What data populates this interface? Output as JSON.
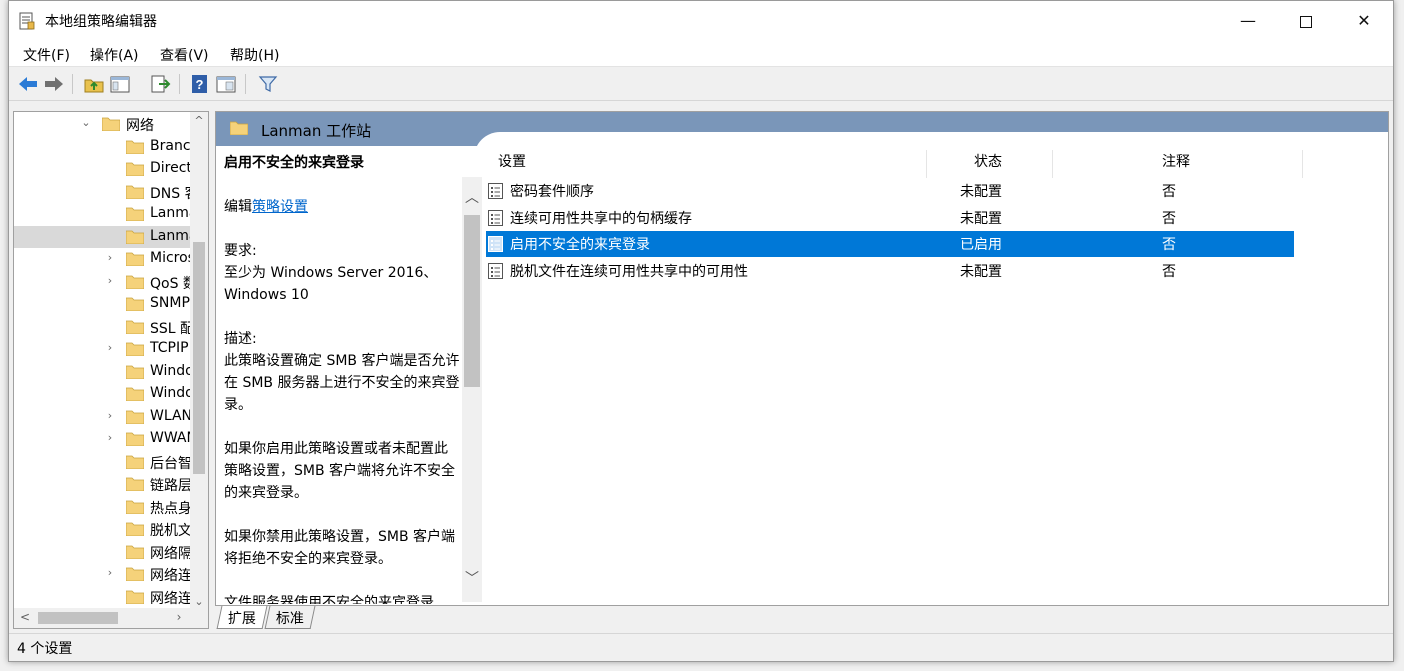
{
  "window": {
    "title": "本地组策略编辑器",
    "controls": {
      "minimize": "—",
      "close": "✕"
    }
  },
  "menu": [
    "文件(F)",
    "操作(A)",
    "查看(V)",
    "帮助(H)"
  ],
  "toolbar": {
    "icons": [
      "back-arrow-icon",
      "forward-arrow-icon",
      "folder-up-icon",
      "console-tree-icon",
      "export-list-icon",
      "help-icon",
      "properties-icon",
      "filter-icon"
    ]
  },
  "tree": {
    "items": [
      {
        "label": "网络",
        "expander": "⌄",
        "level": 0
      },
      {
        "label": "Branch",
        "expander": "",
        "level": 1
      },
      {
        "label": "Direct",
        "expander": "",
        "level": 1
      },
      {
        "label": "DNS 客",
        "expander": "",
        "level": 1
      },
      {
        "label": "Lanma",
        "expander": "",
        "level": 1
      },
      {
        "label": "Lanma",
        "expander": "",
        "level": 1,
        "selected": true
      },
      {
        "label": "Micros",
        "expander": "›",
        "level": 1
      },
      {
        "label": "QoS 数",
        "expander": "›",
        "level": 1
      },
      {
        "label": "SNMP",
        "expander": "",
        "level": 1
      },
      {
        "label": "SSL 配",
        "expander": "",
        "level": 1
      },
      {
        "label": "TCPIP",
        "expander": "›",
        "level": 1
      },
      {
        "label": "Windo",
        "expander": "",
        "level": 1
      },
      {
        "label": "Windo",
        "expander": "",
        "level": 1
      },
      {
        "label": "WLAN",
        "expander": "›",
        "level": 1
      },
      {
        "label": "WWAN",
        "expander": "›",
        "level": 1
      },
      {
        "label": "后台智",
        "expander": "",
        "level": 1
      },
      {
        "label": "链路层",
        "expander": "",
        "level": 1
      },
      {
        "label": "热点身",
        "expander": "",
        "level": 1
      },
      {
        "label": "脱机文",
        "expander": "",
        "level": 1
      },
      {
        "label": "网络隔",
        "expander": "",
        "level": 1
      },
      {
        "label": "网络连",
        "expander": "›",
        "level": 1
      },
      {
        "label": "网络连",
        "expander": "",
        "level": 1
      }
    ],
    "scroll_up": "^",
    "scroll_down": "⌄",
    "scroll_left": "<",
    "scroll_right": "›"
  },
  "header": {
    "title": "Lanman 工作站"
  },
  "description": {
    "heading": "启用不安全的来宾登录",
    "edit_prefix": "编辑",
    "edit_link": "策略设置",
    "requirements_label": "要求:",
    "requirements_text": "至少为 Windows Server 2016、Windows 10",
    "description_label": "描述:",
    "para1": "此策略设置确定 SMB 客户端是否允许在 SMB 服务器上进行不安全的来宾登录。",
    "para2": "如果你启用此策略设置或者未配置此策略设置，SMB 客户端将允许不安全的来宾登录。",
    "para3": "如果你禁用此策略设置，SMB 客户端将拒绝不安全的来宾登录。",
    "para4": "文件服务器使用不安全的来宾登录",
    "scroll_up": "︿",
    "scroll_down": "﹀"
  },
  "list": {
    "columns": [
      "设置",
      "状态",
      "注释"
    ],
    "rows": [
      {
        "name": "密码套件顺序",
        "state": "未配置",
        "comment": "否",
        "selected": false
      },
      {
        "name": "连续可用性共享中的句柄缓存",
        "state": "未配置",
        "comment": "否",
        "selected": false
      },
      {
        "name": "启用不安全的来宾登录",
        "state": "已启用",
        "comment": "否",
        "selected": true
      },
      {
        "name": "脱机文件在连续可用性共享中的可用性",
        "state": "未配置",
        "comment": "否",
        "selected": false
      }
    ]
  },
  "tabs": [
    "扩展",
    "标准"
  ],
  "status": {
    "text": "4 个设置"
  },
  "colors": {
    "header_band": "#7a96b9",
    "selection": "#0078d7",
    "link": "#0066cc",
    "folder": "#f5d27a"
  }
}
